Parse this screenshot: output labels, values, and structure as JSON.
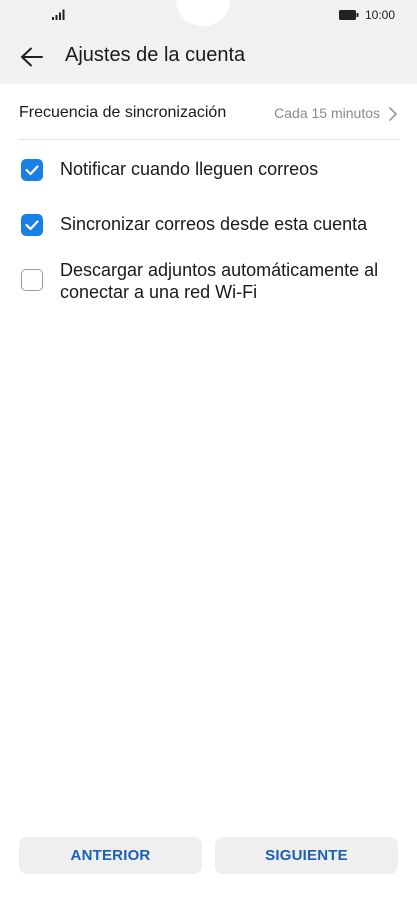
{
  "status_bar": {
    "time": "10:00",
    "signal_icon": "signal-icon",
    "battery_icon": "battery-icon"
  },
  "header": {
    "back_icon": "arrow-left-icon",
    "title": "Ajustes de la cuenta"
  },
  "sync": {
    "label": "Frecuencia de sincronización",
    "value": "Cada 15 minutos",
    "chevron_icon": "chevron-right-icon"
  },
  "options": [
    {
      "label": "Notificar cuando lleguen correos",
      "checked": true
    },
    {
      "label": "Sincronizar correos desde esta cuenta",
      "checked": true
    },
    {
      "label": "Descargar adjuntos automáticamente al conectar a una red Wi-Fi",
      "checked": false
    }
  ],
  "footer": {
    "back_label": "ANTERIOR",
    "next_label": "SIGUIENTE"
  },
  "colors": {
    "accent": "#1a7fe4",
    "button_text": "#1a60b8",
    "bar_bg": "#f1f1f1"
  }
}
